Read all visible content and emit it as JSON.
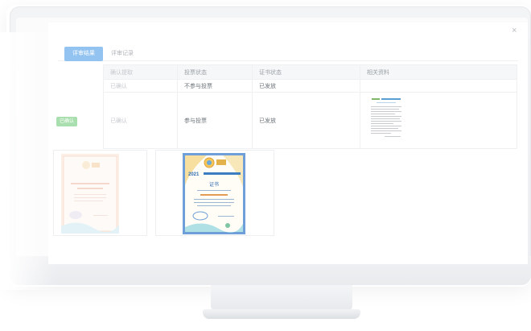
{
  "modal": {
    "close_symbol": "×",
    "tabs": [
      {
        "label": "评审结果",
        "active": true
      },
      {
        "label": "评审记录",
        "active": false
      }
    ]
  },
  "table": {
    "columns": [
      "确认提取",
      "投票状态",
      "证书状态",
      "相关资料"
    ],
    "rows": [
      {
        "confirm": "已确认",
        "vote": "不参与投票",
        "certificate": "已发放",
        "material": ""
      },
      {
        "confirm": "已确认",
        "vote": "参与投票",
        "certificate": "已发放",
        "material": "document-thumbnail"
      }
    ]
  },
  "status_tag": {
    "label": "已确认",
    "color": "#a9dfae"
  },
  "certificates": [
    {
      "name": "certificate-1",
      "faded": true
    },
    {
      "name": "certificate-2",
      "faded": false,
      "heading": "证书",
      "year": "2021"
    }
  ],
  "colors": {
    "accent": "#93c3f0",
    "tag_green": "#a9dfae",
    "border": "#eff0f2",
    "cert_border": "#6f9fd8"
  },
  "icons": {
    "close": "close-icon"
  }
}
